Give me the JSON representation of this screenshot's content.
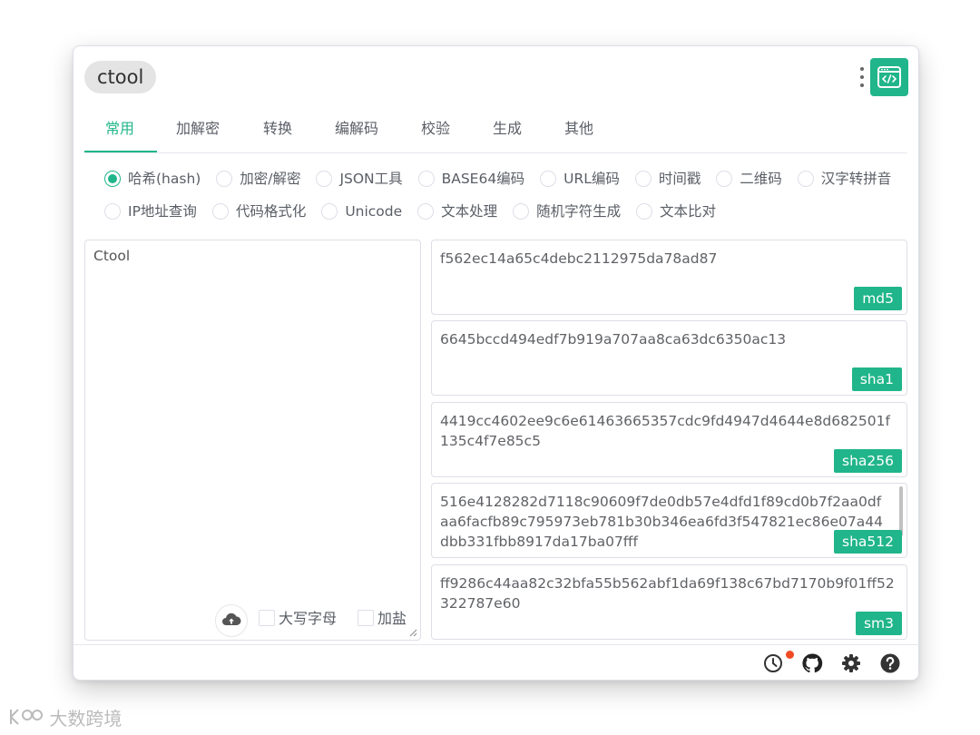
{
  "app": {
    "title": "ctool"
  },
  "tabs": [
    "常用",
    "加解密",
    "转换",
    "编解码",
    "校验",
    "生成",
    "其他"
  ],
  "active_tab": "常用",
  "tools_row1": [
    "哈希(hash)",
    "加密/解密",
    "JSON工具",
    "BASE64编码",
    "URL编码",
    "时间戳",
    "二维码",
    "汉字转拼音"
  ],
  "tools_row2": [
    "IP地址查询",
    "代码格式化",
    "Unicode",
    "文本处理",
    "随机字符生成",
    "文本比对"
  ],
  "selected_tool": "哈希(hash)",
  "input": {
    "text": "Ctool"
  },
  "options": {
    "uppercase_label": "大写字母",
    "salt_label": "加盐"
  },
  "outputs": [
    {
      "algo": "md5",
      "value": "f562ec14a65c4debc2112975da78ad87"
    },
    {
      "algo": "sha1",
      "value": "6645bccd494edf7b919a707aa8ca63dc6350ac13"
    },
    {
      "algo": "sha256",
      "value": "4419cc4602ee9c6e61463665357cdc9fd4947d4644e8d682501f135c4f7e85c5"
    },
    {
      "algo": "sha512",
      "value": "516e4128282d7118c90609f7de0db57e4dfd1f89cd0b7f2aa0dfaa6facfb89c795973eb781b30b346ea6fd3f547821ec86e07a44dbb331fbb8917da17ba07fff"
    },
    {
      "algo": "sm3",
      "value": "ff9286c44aa82c32bfa55b562abf1da69f138c67bd7170b9f01ff52322787e60"
    }
  ],
  "footer_icons": [
    "history-icon",
    "github-icon",
    "settings-icon",
    "help-icon"
  ],
  "watermark": "大数跨境",
  "colors": {
    "accent": "#20b58a",
    "notification": "#f04b24"
  }
}
